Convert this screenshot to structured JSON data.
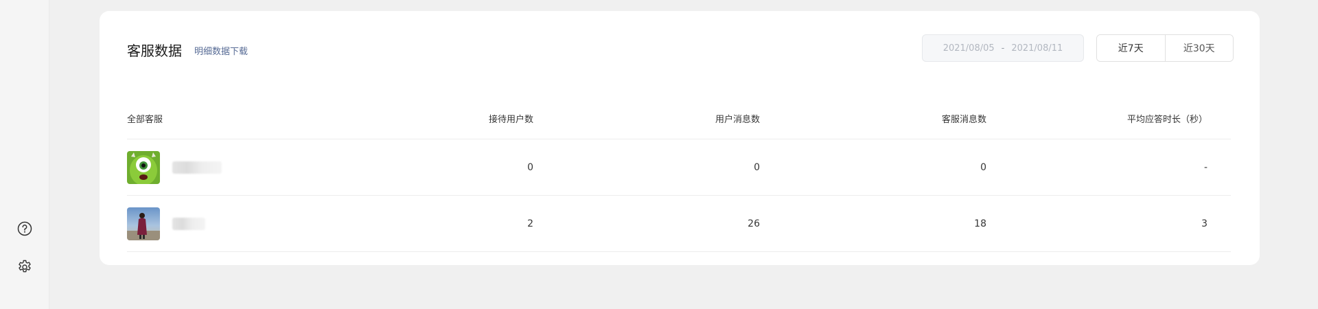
{
  "sidebar": {
    "icons": [
      {
        "name": "help-icon"
      },
      {
        "name": "settings-icon"
      }
    ]
  },
  "card": {
    "title": "客服数据",
    "download_link": "明细数据下载",
    "date_range": {
      "start": "2021/08/05",
      "separator": "-",
      "end": "2021/08/11"
    },
    "range_buttons": [
      "近7天",
      "近30天"
    ]
  },
  "table": {
    "headers": [
      "全部客服",
      "接待用户数",
      "用户消息数",
      "客服消息数",
      "平均应答时长（秒）"
    ],
    "rows": [
      {
        "served_users": "0",
        "user_messages": "0",
        "agent_messages": "0",
        "avg_response": "-"
      },
      {
        "served_users": "2",
        "user_messages": "26",
        "agent_messages": "18",
        "avg_response": "3"
      }
    ]
  }
}
